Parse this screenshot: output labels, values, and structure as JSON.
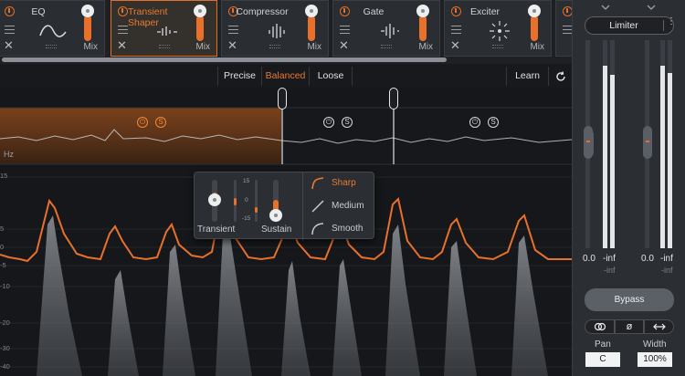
{
  "modules": [
    {
      "name": "EQ",
      "mix_label": "Mix"
    },
    {
      "name": "Transient Shaper",
      "mix_label": "Mix"
    },
    {
      "name": "Compressor",
      "mix_label": "Mix"
    },
    {
      "name": "Gate",
      "mix_label": "Mix"
    },
    {
      "name": "Exciter",
      "mix_label": "Mix"
    }
  ],
  "modes": {
    "precise": "Precise",
    "balanced": "Balanced",
    "loose": "Loose",
    "learn": "Learn"
  },
  "display": {
    "unit": "Hz",
    "db_scale": [
      "15",
      "5",
      "0",
      "-5",
      "-10",
      "-20",
      "-30",
      "-40"
    ]
  },
  "popup": {
    "transient": "Transient",
    "sustain": "Sustain",
    "scale_top": "15",
    "scale_mid": "0",
    "scale_bot": "-15",
    "shapes": [
      "Sharp",
      "Medium",
      "Smooth"
    ],
    "selected_shape": "Sharp"
  },
  "sidebar": {
    "preset": "Limiter",
    "left_vals": {
      "peak": "0.0",
      "rms": "-inf",
      "rms_sub": "-inf"
    },
    "right_vals": {
      "peak": "0.0",
      "rms": "-inf",
      "rms_sub": "-inf"
    },
    "bypass": "Bypass",
    "pan_label": "Pan",
    "pan_value": "C",
    "width_label": "Width",
    "width_value": "100%"
  },
  "colors": {
    "accent": "#e8702a",
    "bg": "#15171a"
  }
}
